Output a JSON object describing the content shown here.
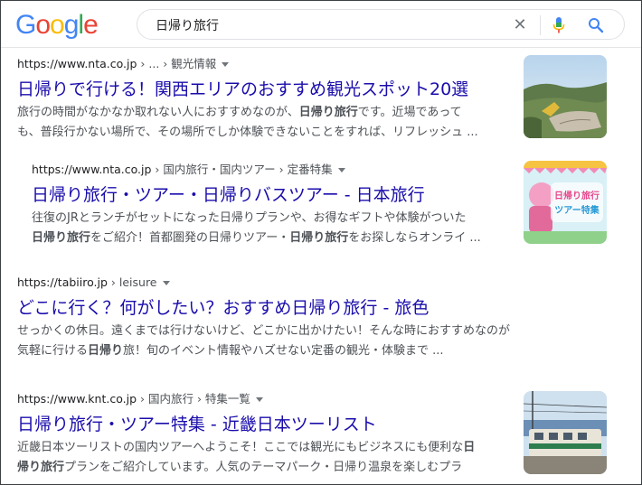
{
  "header": {
    "logo_letters": [
      {
        "ch": "G",
        "color": "#4285f4"
      },
      {
        "ch": "o",
        "color": "#ea4335"
      },
      {
        "ch": "o",
        "color": "#fbbc05"
      },
      {
        "ch": "g",
        "color": "#4285f4"
      },
      {
        "ch": "l",
        "color": "#34a853"
      },
      {
        "ch": "e",
        "color": "#ea4335"
      }
    ],
    "search_query": "日帰り旅行",
    "clear_symbol": "✕"
  },
  "results": [
    {
      "url": "https://www.nta.co.jp",
      "path": " › ... › 観光情報",
      "title": "日帰りで行ける！関西エリアのおすすめ観光スポット20選",
      "line1": [
        {
          "t": "旅行の時間がなかなか取れない人におすすめなのが、",
          "b": false
        },
        {
          "t": "日帰り旅行",
          "b": true
        },
        {
          "t": "です。近場であって",
          "b": false
        }
      ],
      "line2": [
        {
          "t": "も、普段行かない場所で、その場所でしか体験できないことをすれば、リフレッシュ ...",
          "b": false
        }
      ]
    },
    {
      "url": "https://www.nta.co.jp",
      "path": " › 国内旅行・国内ツアー › 定番特集",
      "title": "日帰り旅行・ツアー・日帰りバスツアー - 日本旅行",
      "line1": [
        {
          "t": "往復のJRとランチがセットになった日帰りプランや、お得なギフトや体験がついた",
          "b": false
        }
      ],
      "line2": [
        {
          "t": "日帰り旅行",
          "b": true
        },
        {
          "t": "をご紹介！首都圏発の日帰りツアー・",
          "b": false
        },
        {
          "t": "日帰り旅行",
          "b": true
        },
        {
          "t": "をお探しならオンライ ...",
          "b": false
        }
      ],
      "thumb_text": "日帰り旅行 ツアー特集"
    },
    {
      "url": "https://tabiiro.jp",
      "path": " › leisure",
      "title": "どこに行く？何がしたい？おすすめ日帰り旅行 - 旅色",
      "line1": [
        {
          "t": "せっかくの休日。遠くまでは行けないけど、どこかに出かけたい！そんな時におすすめなのが",
          "b": false
        }
      ],
      "line2": [
        {
          "t": "気軽に行ける",
          "b": false
        },
        {
          "t": "日帰り",
          "b": true
        },
        {
          "t": "旅！旬のイベント情報やハズせない定番の観光・体験まで ...",
          "b": false
        }
      ]
    },
    {
      "url": "https://www.knt.co.jp",
      "path": " › 国内旅行 › 特集一覧",
      "title": "日帰り旅行・ツアー特集 - 近畿日本ツーリスト",
      "line1": [
        {
          "t": "近畿日本ツーリストの国内ツアーへようこそ！ここでは観光にもビジネスにも便利な",
          "b": false
        },
        {
          "t": "日",
          "b": true
        }
      ],
      "line2": [
        {
          "t": "帰り旅行",
          "b": true
        },
        {
          "t": "プランをご紹介しています。人気のテーマパーク・日帰り温泉を楽しむプラ",
          "b": false
        }
      ]
    }
  ]
}
